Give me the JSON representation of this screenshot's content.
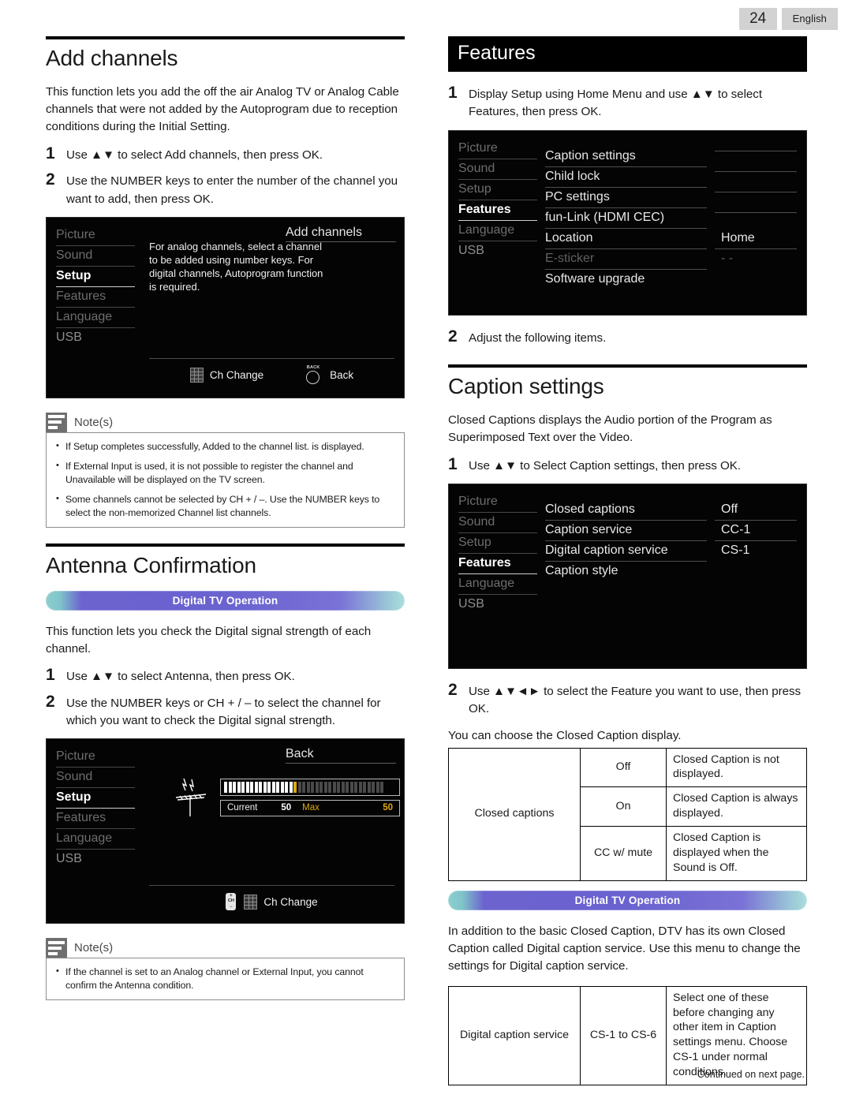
{
  "header": {
    "page_number": "24",
    "language": "English"
  },
  "left": {
    "add_channels": {
      "title": "Add channels",
      "intro": "This function lets you add the off the air Analog TV or Analog Cable channels that were not added by the Autoprogram due to reception conditions during the Initial Setting.",
      "step1_num": "1",
      "step1_text": "Use ▲▼ to select Add channels, then press OK.",
      "step2_num": "2",
      "step2_text": "Use the NUMBER keys to enter the number of the channel you want to add, then press OK."
    },
    "menu_add_channels": {
      "sidebar": [
        "Picture",
        "Sound",
        "Setup",
        "Features",
        "Language",
        "USB"
      ],
      "active_item": "Setup",
      "right_title": "Add channels",
      "description": "For analog channels, select a channel to be added using number keys. For digital channels, Autoprogram function is required.",
      "footer_buttons": [
        {
          "icon": "keypad-icon",
          "label": "Ch Change"
        },
        {
          "icon": "back-button-icon",
          "label": "Back"
        }
      ]
    },
    "notes_1": {
      "title": "Note(s)",
      "items": [
        "If Setup completes successfully, Added to the channel list. is displayed.",
        "If External Input is used, it is not possible to register the channel and Unavailable will be displayed on the TV screen.",
        "Some channels cannot be selected by CH + / –. Use the NUMBER keys to select the non-memorized Channel list channels."
      ]
    },
    "antenna": {
      "title": "Antenna Confirmation",
      "badge": "Digital TV Operation",
      "intro": "This function lets you check the Digital signal strength of each channel.",
      "step1_num": "1",
      "step1_text": "Use ▲▼ to select Antenna, then press OK.",
      "step2_num": "2",
      "step2_text": "Use the NUMBER keys or CH + / – to select the channel for which you want to check the Digital signal strength."
    },
    "menu_antenna": {
      "sidebar": [
        "Picture",
        "Sound",
        "Setup",
        "Features",
        "Language",
        "USB"
      ],
      "active_item": "Setup",
      "right_title": "Back",
      "meter": {
        "current_label": "Current",
        "current_value": "50",
        "max_label": "Max",
        "max_value": "50",
        "filled_bars": 16,
        "marker_bars": 1,
        "empty_bars": 20,
        "marker_color": "#e0a80f"
      },
      "footer_buttons": [
        {
          "icon": "ch-plus-minus-icon",
          "label": ""
        },
        {
          "icon": "keypad-icon",
          "label": "Ch Change"
        }
      ]
    },
    "notes_2": {
      "title": "Note(s)",
      "items": [
        "If the channel is set to an Analog channel or External Input, you cannot confirm the Antenna condition."
      ]
    }
  },
  "right": {
    "features": {
      "title": "Features",
      "step1_num": "1",
      "step1_text": "Display Setup using Home Menu and use ▲▼ to select Features, then press OK.",
      "step2_num": "2",
      "step2_text": "Adjust the following items."
    },
    "menu_features": {
      "sidebar": [
        "Picture",
        "Sound",
        "Setup",
        "Features",
        "Language",
        "USB"
      ],
      "active_item": "Features",
      "rows": [
        {
          "name": "Caption settings",
          "value": ""
        },
        {
          "name": "Child lock",
          "value": ""
        },
        {
          "name": "PC settings",
          "value": ""
        },
        {
          "name": "fun-Link (HDMI CEC)",
          "value": ""
        },
        {
          "name": "Location",
          "value": "Home"
        },
        {
          "name": "E-sticker",
          "value": "- -",
          "dim": true
        },
        {
          "name": "Software upgrade",
          "value": ""
        }
      ]
    },
    "caption_settings": {
      "title": "Caption settings",
      "intro": "Closed Captions displays the Audio portion of the Program as Superimposed Text over the Video.",
      "step1_num": "1",
      "step1_text": "Use ▲▼ to Select Caption settings, then press OK."
    },
    "menu_caption": {
      "sidebar": [
        "Picture",
        "Sound",
        "Setup",
        "Features",
        "Language",
        "USB"
      ],
      "active_item": "Features",
      "rows": [
        {
          "name": "Closed captions",
          "value": "Off"
        },
        {
          "name": "Caption service",
          "value": "CC-1"
        },
        {
          "name": "Digital caption service",
          "value": "CS-1"
        },
        {
          "name": "Caption style",
          "value": ""
        }
      ]
    },
    "caption_step2_num": "2",
    "caption_step2_text": "Use ▲▼◄► to select the Feature you want to use, then press OK.",
    "closed_caption_lead": "You can choose the Closed Caption display.",
    "closed_caption_table": {
      "label": "Closed captions",
      "rows": [
        {
          "option": "Off",
          "description": "Closed Caption is not displayed."
        },
        {
          "option": "On",
          "description": "Closed Caption is always displayed."
        },
        {
          "option": "CC w/ mute",
          "description": "Closed Caption is displayed when the Sound is Off."
        }
      ]
    },
    "dtv_badge_2": "Digital TV Operation",
    "dtv_paragraph": "In addition to the basic Closed Caption, DTV has its own Closed Caption called Digital caption service. Use this menu to change the settings for Digital caption service.",
    "digital_caption_table": {
      "label": "Digital caption service",
      "range": "CS-1 to CS-6",
      "description": "Select one of these before changing any other item in Caption settings menu. Choose CS-1 under normal conditions."
    }
  },
  "footer": {
    "continued": "Continued on next page."
  }
}
